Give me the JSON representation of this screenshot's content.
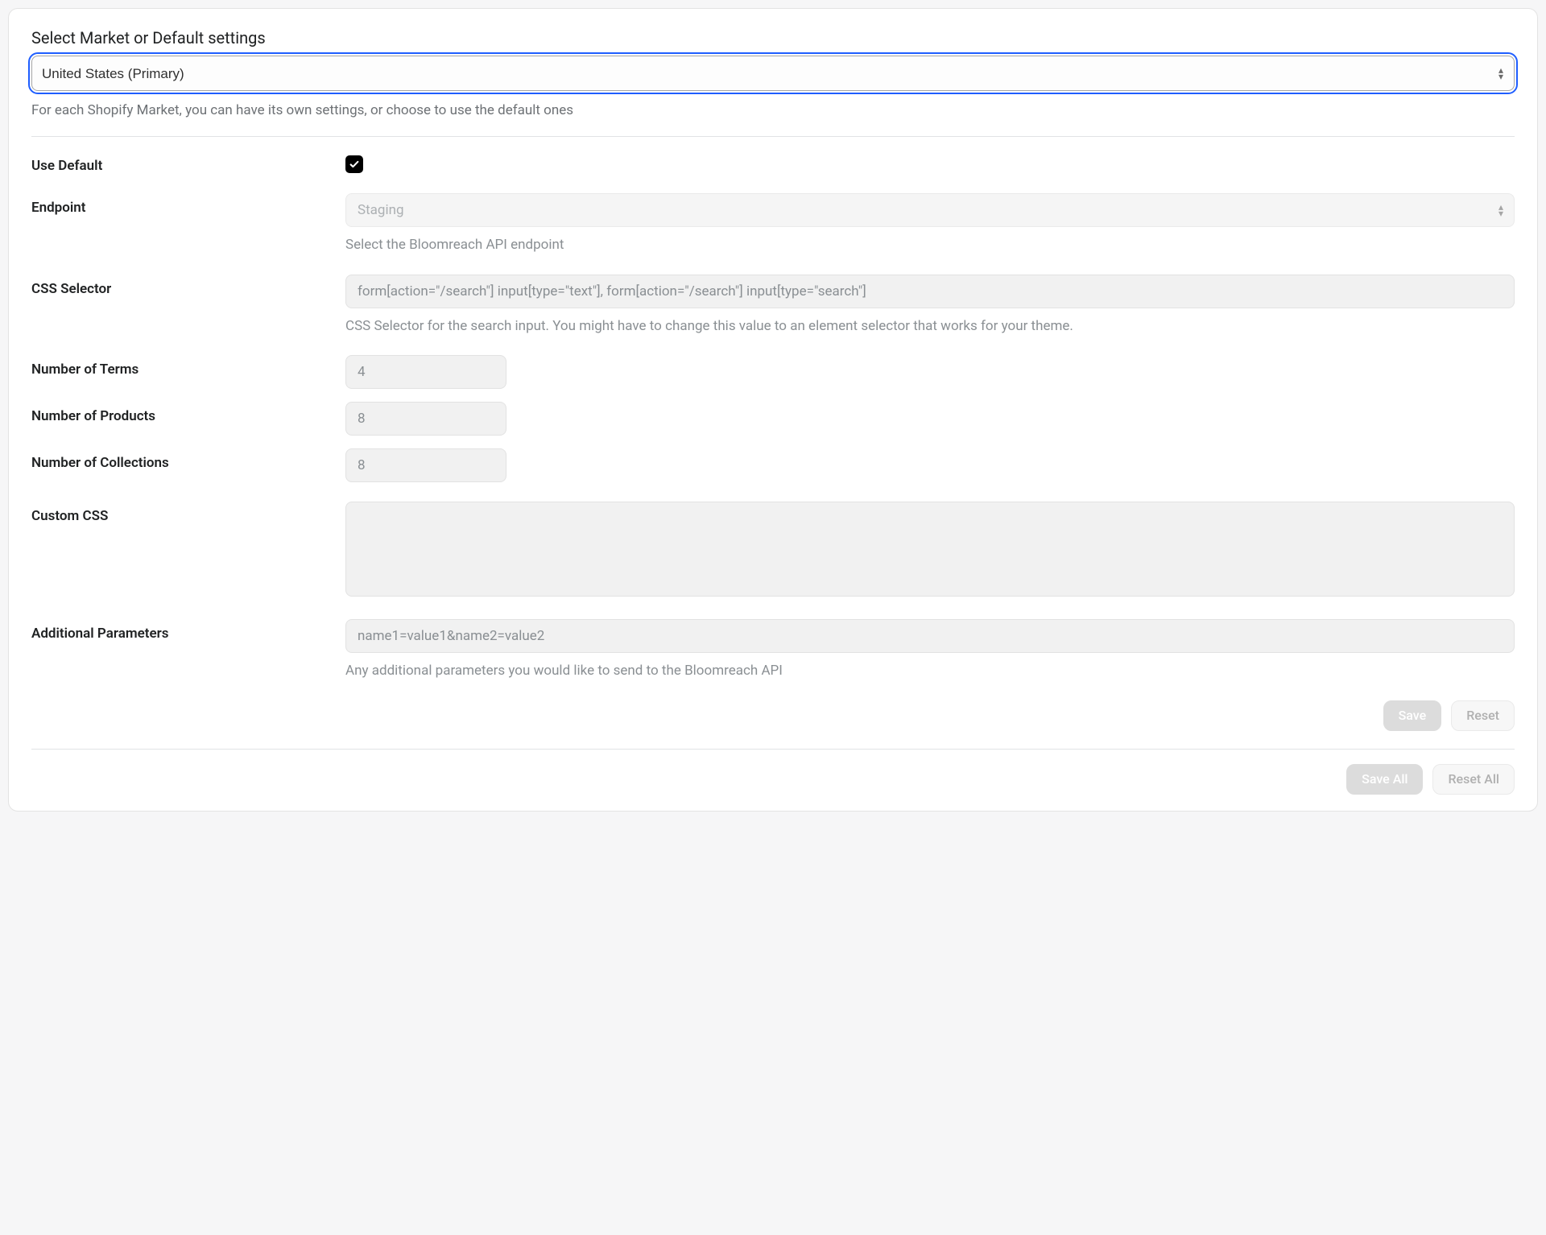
{
  "market": {
    "title": "Select Market or Default settings",
    "selected": "United States (Primary)",
    "help": "For each Shopify Market, you can have its own settings, or choose to use the default ones"
  },
  "labels": {
    "use_default": "Use Default",
    "endpoint": "Endpoint",
    "css_selector": "CSS Selector",
    "num_terms": "Number of Terms",
    "num_products": "Number of Products",
    "num_collections": "Number of Collections",
    "custom_css": "Custom CSS",
    "additional_params": "Additional Parameters"
  },
  "fields": {
    "use_default_checked": true,
    "endpoint": {
      "value": "Staging",
      "help": "Select the Bloomreach API endpoint"
    },
    "css_selector": {
      "placeholder": "form[action=\"/search\"] input[type=\"text\"], form[action=\"/search\"] input[type=\"search\"]",
      "help": "CSS Selector for the search input. You might have to change this value to an element selector that works for your theme."
    },
    "num_terms": {
      "placeholder": "4"
    },
    "num_products": {
      "placeholder": "8"
    },
    "num_collections": {
      "placeholder": "8"
    },
    "custom_css": {
      "value": ""
    },
    "additional_params": {
      "placeholder": "name1=value1&name2=value2",
      "help": "Any additional parameters you would like to send to the Bloomreach API"
    }
  },
  "buttons": {
    "save": "Save",
    "reset": "Reset",
    "save_all": "Save All",
    "reset_all": "Reset All"
  }
}
